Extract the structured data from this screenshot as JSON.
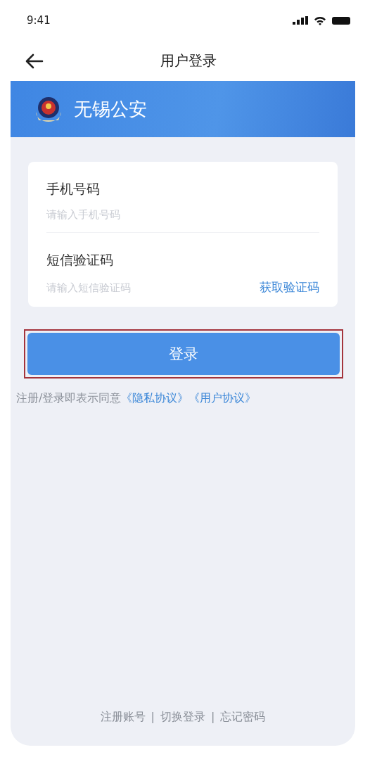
{
  "status_bar": {
    "time": "9:41"
  },
  "nav": {
    "title": "用户登录"
  },
  "header": {
    "title": "无锡公安"
  },
  "form": {
    "fields": [
      {
        "label": "手机号码",
        "placeholder": "请输入手机号码"
      },
      {
        "label": "短信验证码",
        "placeholder": "请输入短信验证码",
        "action": "获取验证码"
      }
    ]
  },
  "login_button": {
    "label": "登录",
    "highlighted": true
  },
  "agreement": {
    "text": "注册/登录即表示同意",
    "links": [
      "《隐私协议》",
      "《用户协议》"
    ]
  },
  "footer": {
    "links": [
      "注册账号",
      "切换登录",
      "忘记密码"
    ],
    "separator": "|"
  }
}
